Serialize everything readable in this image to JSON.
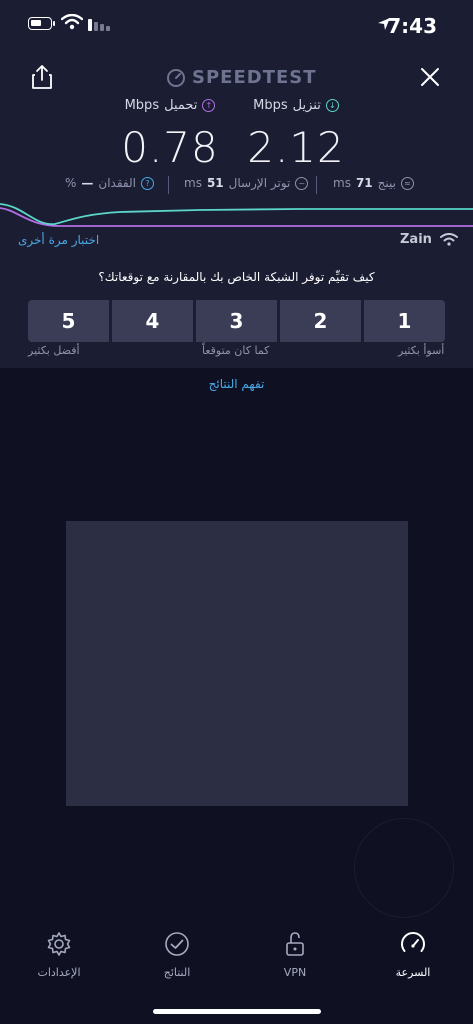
{
  "status_bar": {
    "time": "7:43",
    "battery_icon": "battery-icon",
    "wifi_icon": "wifi-icon",
    "cellular_icon": "cellular-signal-icon",
    "location_icon": "location-arrow-icon"
  },
  "header": {
    "logo": "SPEEDTEST",
    "share_icon": "share-icon",
    "close_icon": "close-icon"
  },
  "results": {
    "download": {
      "label": "تنزيل",
      "unit": "Mbps",
      "value": "2.12",
      "icon_color": "#5bd6c9"
    },
    "upload": {
      "label": "تحميل",
      "unit": "Mbps",
      "value": "0.78",
      "icon_color": "#b36ee6"
    }
  },
  "stats": {
    "ping": {
      "label": "بينج",
      "value": "71",
      "unit": "ms"
    },
    "jitter": {
      "label": "توتر الإرسال",
      "value": "51",
      "unit": "ms"
    },
    "loss": {
      "label": "الفقدان",
      "value": "—",
      "unit": "%"
    }
  },
  "actions": {
    "retry": "اختبار مرة أخرى",
    "isp": "Zain"
  },
  "survey": {
    "question": "كيف تقيِّم توفر الشبكة الخاص بك بالمقارنة مع توقعاتك؟",
    "options": [
      "5",
      "4",
      "3",
      "2",
      "1"
    ],
    "label_best": "أفضل بكثير",
    "label_mid": "كما كان متوقعاً",
    "label_worst": "أسوأ بكثير"
  },
  "understand_link": "تفهم النتائج",
  "tabs": {
    "settings": "الإعدادات",
    "results": "النتائج",
    "vpn": "VPN",
    "speed": "السرعة"
  },
  "colors": {
    "background_top": "#1b1d33",
    "background_bottom": "#0f1122",
    "accent_link": "#4aa9e6",
    "download": "#5bd6c9",
    "upload": "#b36ee6"
  }
}
